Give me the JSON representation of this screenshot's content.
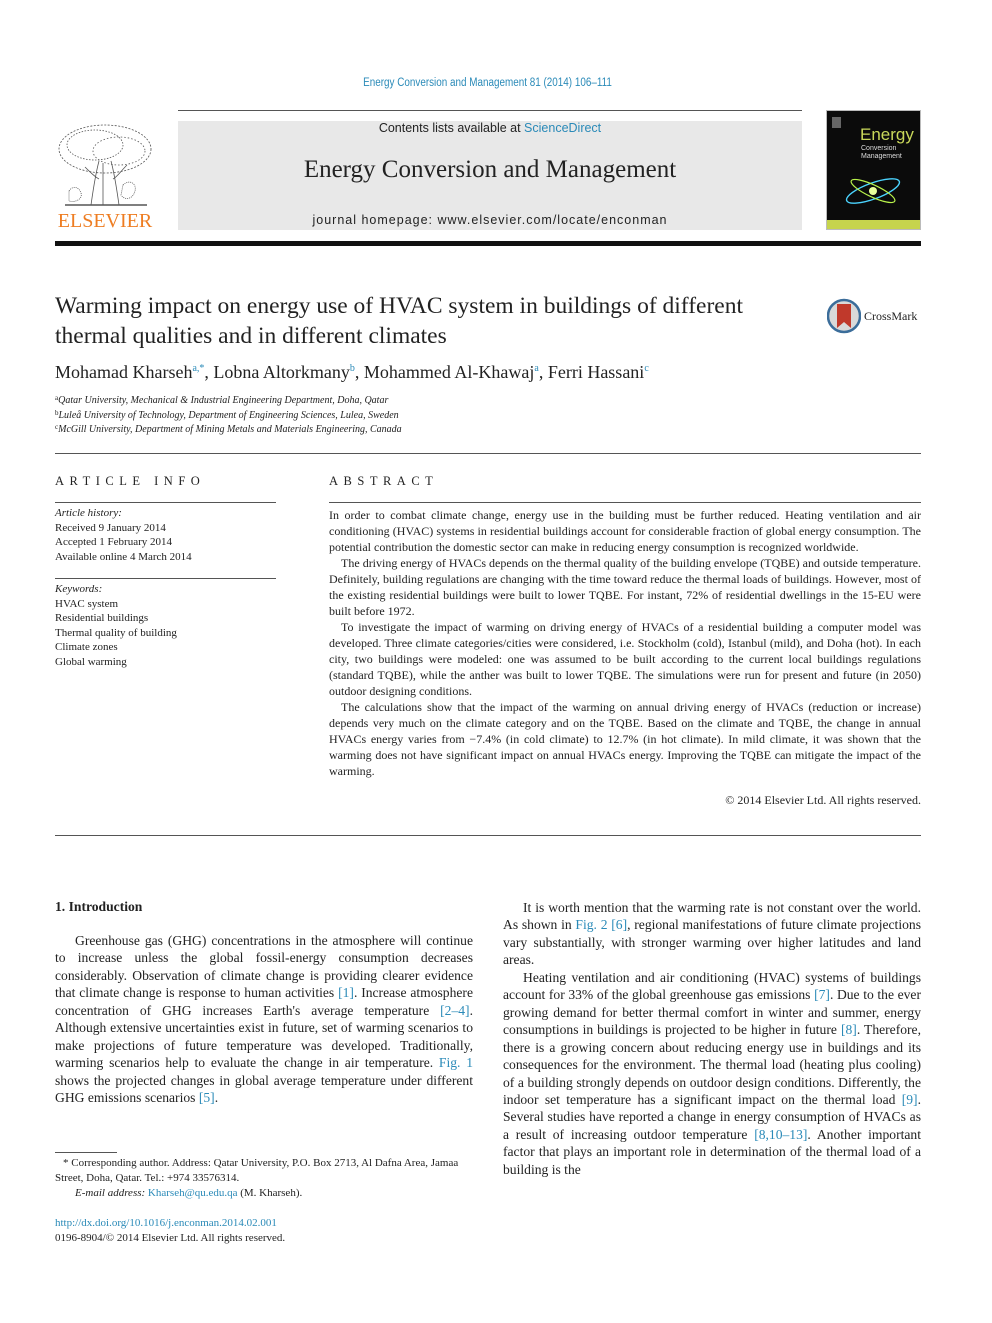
{
  "running_head": "Energy Conversion and Management 81 (2014) 106–111",
  "banner": {
    "contents_prefix": "Contents lists available at ",
    "contents_link": "ScienceDirect",
    "journal_title": "Energy Conversion and Management",
    "homepage": "journal homepage: www.elsevier.com/locate/enconman"
  },
  "publisher_logo": {
    "wordmark": "ELSEVIER",
    "color": "#ee7d22"
  },
  "cover": {
    "line1": "Energy",
    "line2": "Conversion",
    "line3": "Management"
  },
  "crossmark": {
    "label": "CrossMark"
  },
  "article_title": "Warming impact on energy use of HVAC system in buildings of different thermal qualities and in different climates",
  "authors": [
    {
      "name": "Mohamad Kharseh",
      "sup": "a,*",
      "sep": ", "
    },
    {
      "name": "Lobna Altorkmany",
      "sup": "b",
      "sep": ", "
    },
    {
      "name": "Mohammed Al-Khawaj",
      "sup": "a",
      "sep": ", "
    },
    {
      "name": "Ferri Hassani",
      "sup": "c",
      "sep": ""
    }
  ],
  "affiliations": [
    {
      "key": "a",
      "text": "Qatar University, Mechanical & Industrial Engineering Department, Doha, Qatar"
    },
    {
      "key": "b",
      "text": "Luleå University of Technology, Department of Engineering Sciences, Lulea, Sweden"
    },
    {
      "key": "c",
      "text": "McGill University, Department of Mining Metals and Materials Engineering, Canada"
    }
  ],
  "article_info": {
    "heading": "ARTICLE INFO",
    "history_label": "Article history:",
    "history": [
      "Received 9 January 2014",
      "Accepted 1 February 2014",
      "Available online 4 March 2014"
    ],
    "keywords_label": "Keywords:",
    "keywords": [
      "HVAC system",
      "Residential buildings",
      "Thermal quality of building",
      "Climate zones",
      "Global warming"
    ]
  },
  "abstract": {
    "heading": "ABSTRACT",
    "paragraphs": [
      "In order to combat climate change, energy use in the building must be further reduced. Heating ventilation and air conditioning (HVAC) systems in residential buildings account for considerable fraction of global energy consumption. The potential contribution the domestic sector can make in reducing energy consumption is recognized worldwide.",
      "The driving energy of HVACs depends on the thermal quality of the building envelope (TQBE) and outside temperature. Definitely, building regulations are changing with the time toward reduce the thermal loads of buildings. However, most of the existing residential buildings were built to lower TQBE. For instant, 72% of residential dwellings in the 15-EU were built before 1972.",
      "To investigate the impact of warming on driving energy of HVACs of a residential building a computer model was developed. Three climate categories/cities were considered, i.e. Stockholm (cold), Istanbul (mild), and Doha (hot). In each city, two buildings were modeled: one was assumed to be built according to the current local buildings regulations (standard TQBE), while the anther was built to lower TQBE. The simulations were run for present and future (in 2050) outdoor designing conditions.",
      "The calculations show that the impact of the warming on annual driving energy of HVACs (reduction or increase) depends very much on the climate category and on the TQBE. Based on the climate and TQBE, the change in annual HVACs energy varies from −7.4% (in cold climate) to 12.7% (in hot climate). In mild climate, it was shown that the warming does not have significant impact on annual HVACs energy. Improving the TQBE can mitigate the impact of the warming."
    ],
    "copyright": "© 2014 Elsevier Ltd. All rights reserved."
  },
  "introduction": {
    "heading": "1. Introduction",
    "left_p1": [
      {
        "t": "Greenhouse gas (GHG) concentrations in the atmosphere will continue to increase unless the global fossil-energy consumption decreases considerably. Observation of climate change is providing clearer evidence that climate change is response to human activities "
      },
      {
        "link": "[1]"
      },
      {
        "t": ". Increase atmosphere concentration of GHG increases Earth's average temperature "
      },
      {
        "link": "[2–4]"
      },
      {
        "t": ". Although extensive uncertainties exist in future, set of warming scenarios to make projections of future temperature was developed. Traditionally, warming scenarios help to evaluate the change in air temperature. "
      },
      {
        "link": "Fig. 1"
      },
      {
        "t": " shows the projected changes in global average temperature under different GHG emissions scenarios "
      },
      {
        "link": "[5]"
      },
      {
        "t": "."
      }
    ],
    "right_p1": [
      {
        "t": "It is worth mention that the warming rate is not constant over the world. As shown in "
      },
      {
        "link": "Fig. 2"
      },
      {
        "t": " "
      },
      {
        "link": "[6]"
      },
      {
        "t": ", regional manifestations of future climate projections vary substantially, with stronger warming over higher latitudes and land areas."
      }
    ],
    "right_p2": [
      {
        "t": "Heating ventilation and air conditioning (HVAC) systems of buildings account for 33% of the global greenhouse gas emissions "
      },
      {
        "link": "[7]"
      },
      {
        "t": ". Due to the ever growing demand for better thermal comfort in winter and summer, energy consumptions in buildings is projected to be higher in future "
      },
      {
        "link": "[8]"
      },
      {
        "t": ". Therefore, there is a growing concern about reducing energy use in buildings and its consequences for the environment. The thermal load (heating plus cooling) of a building strongly depends on outdoor design conditions. Differently, the indoor set temperature has a significant impact on the thermal load "
      },
      {
        "link": "[9]"
      },
      {
        "t": ". Several studies have reported a change in energy consumption of HVACs as a result of increasing outdoor temperature "
      },
      {
        "link": "[8,10–13]"
      },
      {
        "t": ". Another important factor that plays an important role in determination of the thermal load of a building is the"
      }
    ]
  },
  "footnote": {
    "corresponding": "* Corresponding author. Address: Qatar University, P.O. Box 2713, Al Dafna Area, Jamaa Street, Doha, Qatar. Tel.: +974 33576314.",
    "email_label": "E-mail address:",
    "email": "Kharseh@qu.edu.qa",
    "email_suffix": " (M. Kharseh).",
    "doi": "http://dx.doi.org/10.1016/j.enconman.2014.02.001",
    "issn": "0196-8904/© 2014 Elsevier Ltd. All rights reserved."
  }
}
